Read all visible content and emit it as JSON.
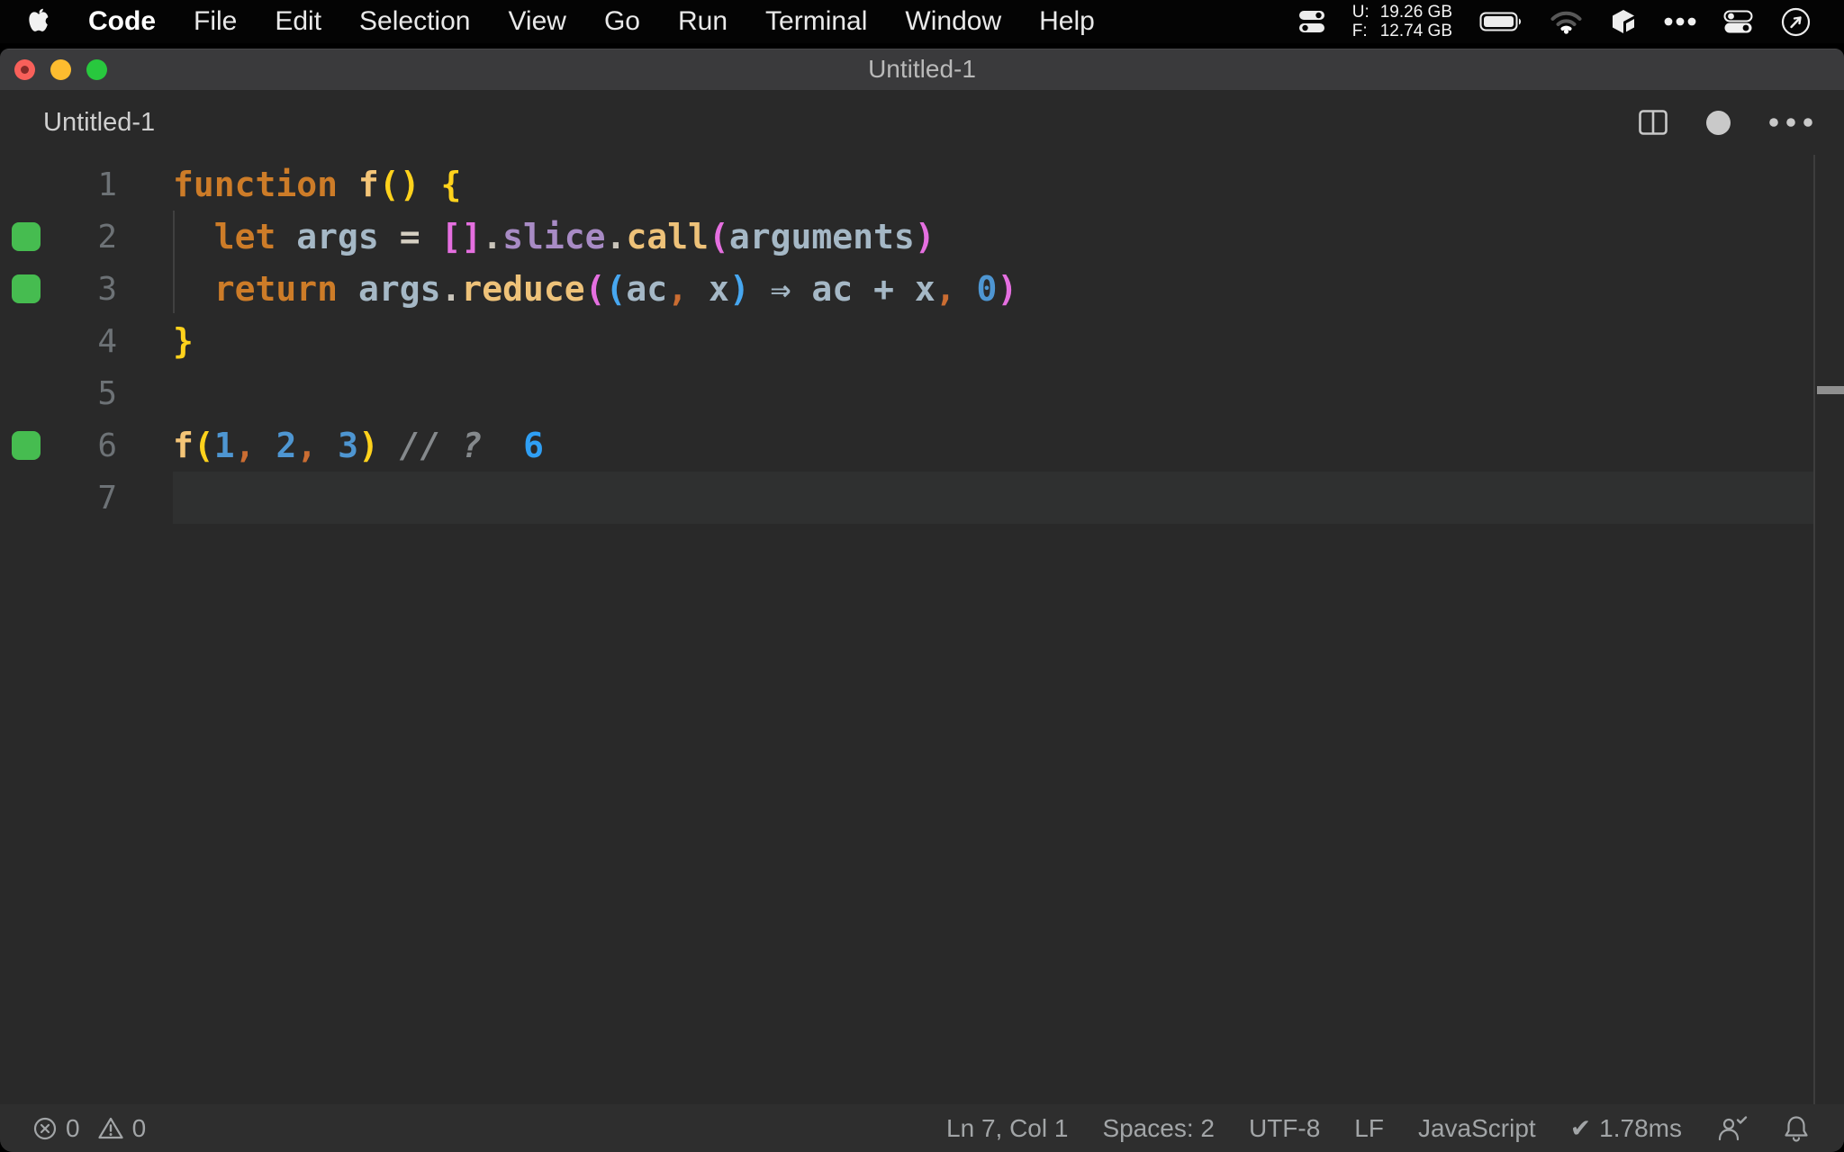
{
  "menu_bar": {
    "app_name": "Code",
    "items": [
      "File",
      "Edit",
      "Selection",
      "View",
      "Go",
      "Run",
      "Terminal",
      "Window",
      "Help"
    ],
    "memory": {
      "used_label": "U:",
      "used_value": "19.26 GB",
      "free_label": "F:",
      "free_value": "12.74 GB"
    },
    "right_icons": [
      "stats-toggles-icon",
      "battery-icon",
      "wifi-icon",
      "cube-app-icon",
      "more-dots-icon",
      "control-center-icon",
      "compass-arrow-icon"
    ]
  },
  "window": {
    "title": "Untitled-1",
    "tab_label": "Untitled-1",
    "tab_action_icons": [
      "split-editor-icon",
      "unsaved-dirty-dot",
      "more-actions-icon"
    ]
  },
  "editor": {
    "line_count": 7,
    "current_line": 7,
    "coverage_lines": [
      2,
      3,
      6
    ],
    "token_styles": {
      "default": {
        "color": "#a5b8c6"
      },
      "kw": {
        "color": "#cd7c28"
      },
      "fn": {
        "color": "#f4c577"
      },
      "call": {
        "color": "#eec279"
      },
      "prop": {
        "color": "#a88bc5"
      },
      "eq": {
        "color": "#d5cfc2"
      },
      "dot": {
        "color": "#c9c4ba"
      },
      "b1": {
        "color": "#ffd21c"
      },
      "b2": {
        "color": "#e56fe0"
      },
      "b3": {
        "color": "#47a7f0"
      },
      "num": {
        "color": "#4e96d2"
      },
      "comma": {
        "color": "#cb6d32"
      },
      "cmt": {
        "color": "#85898c",
        "italic": true
      },
      "res": {
        "color": "#2f9ff4"
      }
    },
    "lines": [
      {
        "n": 1,
        "tokens": [
          [
            "function",
            "kw"
          ],
          [
            " "
          ],
          [
            "f",
            "fn"
          ],
          [
            "(",
            "b1"
          ],
          [
            ")",
            "b1"
          ],
          [
            " "
          ],
          [
            "{",
            "b1"
          ]
        ]
      },
      {
        "n": 2,
        "tokens": [
          [
            "  "
          ],
          [
            "let",
            "kw"
          ],
          [
            " "
          ],
          [
            "args"
          ],
          [
            " "
          ],
          [
            "=",
            "eq"
          ],
          [
            " "
          ],
          [
            "[",
            "b2"
          ],
          [
            "]",
            "b2"
          ],
          [
            ".",
            "dot"
          ],
          [
            "slice",
            "prop"
          ],
          [
            ".",
            "dot"
          ],
          [
            "call",
            "call"
          ],
          [
            "(",
            "b2"
          ],
          [
            "arguments"
          ],
          [
            ")",
            "b2"
          ]
        ]
      },
      {
        "n": 3,
        "tokens": [
          [
            "  "
          ],
          [
            "return",
            "kw"
          ],
          [
            " "
          ],
          [
            "args"
          ],
          [
            ".",
            "dot"
          ],
          [
            "reduce",
            "call"
          ],
          [
            "(",
            "b2"
          ],
          [
            "(",
            "b3"
          ],
          [
            "ac"
          ],
          [
            ",",
            "comma"
          ],
          [
            " "
          ],
          [
            "x"
          ],
          [
            ")",
            "b3"
          ],
          [
            " "
          ],
          [
            "⇒"
          ],
          [
            " "
          ],
          [
            "ac"
          ],
          [
            " "
          ],
          [
            "+"
          ],
          [
            " "
          ],
          [
            "x"
          ],
          [
            ",",
            "comma"
          ],
          [
            " "
          ],
          [
            "0",
            "num"
          ],
          [
            ")",
            "b2"
          ]
        ]
      },
      {
        "n": 4,
        "tokens": [
          [
            "}",
            "b1"
          ]
        ]
      },
      {
        "n": 5,
        "tokens": []
      },
      {
        "n": 6,
        "tokens": [
          [
            "f",
            "fn"
          ],
          [
            "(",
            "b1"
          ],
          [
            "1",
            "num"
          ],
          [
            ",",
            "comma"
          ],
          [
            " "
          ],
          [
            "2",
            "num"
          ],
          [
            ",",
            "comma"
          ],
          [
            " "
          ],
          [
            "3",
            "num"
          ],
          [
            ")",
            "b1"
          ],
          [
            " "
          ],
          [
            "//",
            "cmt"
          ],
          [
            " "
          ],
          [
            "?",
            "cmt"
          ],
          [
            "  "
          ],
          [
            "6",
            "res"
          ]
        ]
      },
      {
        "n": 7,
        "tokens": []
      }
    ]
  },
  "status_bar": {
    "errors": "0",
    "warnings": "0",
    "items": [
      {
        "name": "cursor-position",
        "label": "Ln 7, Col 1"
      },
      {
        "name": "indentation",
        "label": "Spaces: 2"
      },
      {
        "name": "encoding",
        "label": "UTF-8"
      },
      {
        "name": "eol",
        "label": "LF"
      },
      {
        "name": "language",
        "label": "JavaScript"
      }
    ],
    "perf_check": "✔",
    "perf_value": "1.78ms",
    "right_icons": [
      "feedback-person-icon",
      "bell-icon"
    ]
  },
  "colors": {
    "menubar_bg": "#040404",
    "titlebar_bg": "#3a3a3c",
    "editor_bg": "#292929",
    "statusbar_bg": "#2e2e2e",
    "current_line_bg": "#2f3030",
    "coverage_green": "#46bc50",
    "traffic_red": "#f8605a",
    "traffic_yellow": "#fdbc2f",
    "traffic_green": "#28c83e"
  }
}
